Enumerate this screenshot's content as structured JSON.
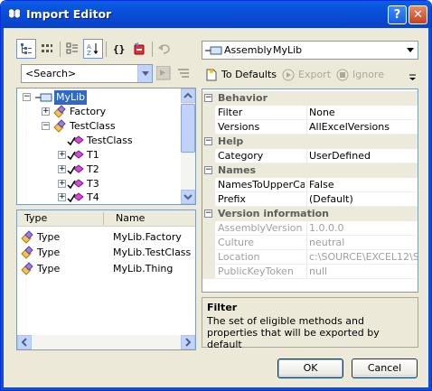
{
  "window": {
    "title": "Import Editor",
    "help_glyph": "?",
    "close_glyph": "✕",
    "icon": "butterfly-icon",
    "title_color": "#ffffff",
    "titlebar_color": "#0a4fd9"
  },
  "left_toolbar": {
    "buttons": [
      "hierarchy-view-icon",
      "sort-type-icon",
      "categorized-icon",
      "sort-alpha-icon",
      "braces-icon",
      "remove-icon",
      "undo-icon"
    ]
  },
  "search": {
    "value": "<Search>"
  },
  "tree": {
    "nodes": [
      {
        "label": "MyLib",
        "icon": "assembly-icon",
        "selected": true
      },
      {
        "label": "Factory",
        "icon": "class-icon"
      },
      {
        "label": "TestClass",
        "icon": "class-icon"
      },
      {
        "label": "TestClass",
        "icon": "method-icon"
      },
      {
        "label": "T1",
        "icon": "method-icon"
      },
      {
        "label": "T2",
        "icon": "method-icon"
      },
      {
        "label": "T3",
        "icon": "method-icon"
      },
      {
        "label": "T4",
        "icon": "method-icon"
      }
    ]
  },
  "list": {
    "headers": [
      "Type",
      "Name"
    ],
    "rows": [
      {
        "type": "Type",
        "name": "MyLib.Factory"
      },
      {
        "type": "Type",
        "name": "MyLib.TestClass"
      },
      {
        "type": "Type",
        "name": "MyLib.Thing"
      }
    ]
  },
  "selector": {
    "kind": "Assembly",
    "name": "MyLib"
  },
  "right_toolbar": {
    "to_defaults": "To Defaults",
    "export": "Export",
    "ignore": "Ignore"
  },
  "grid": {
    "behavior": {
      "title": "Behavior",
      "rows": [
        {
          "name": "Filter",
          "value": "None"
        },
        {
          "name": "Versions",
          "value": "AllExcelVersions"
        }
      ]
    },
    "help": {
      "title": "Help",
      "rows": [
        {
          "name": "Category",
          "value": "UserDefined"
        }
      ]
    },
    "names": {
      "title": "Names",
      "rows": [
        {
          "name": "NamesToUpperCas",
          "value": "False"
        },
        {
          "name": "Prefix",
          "value": "(Default)"
        }
      ]
    },
    "version": {
      "title": "Version information",
      "rows": [
        {
          "name": "AssemblyVersion",
          "value": "1.0.0.0"
        },
        {
          "name": "Culture",
          "value": "neutral"
        },
        {
          "name": "Location",
          "value": "c:\\SOURCE\\EXCEL12\\S"
        },
        {
          "name": "PublicKeyToken",
          "value": "null"
        }
      ]
    }
  },
  "description": {
    "title": "Filter",
    "text": "The set of eligible methods and properties that will be exported by default"
  },
  "buttons": {
    "ok": "OK",
    "cancel": "Cancel"
  }
}
